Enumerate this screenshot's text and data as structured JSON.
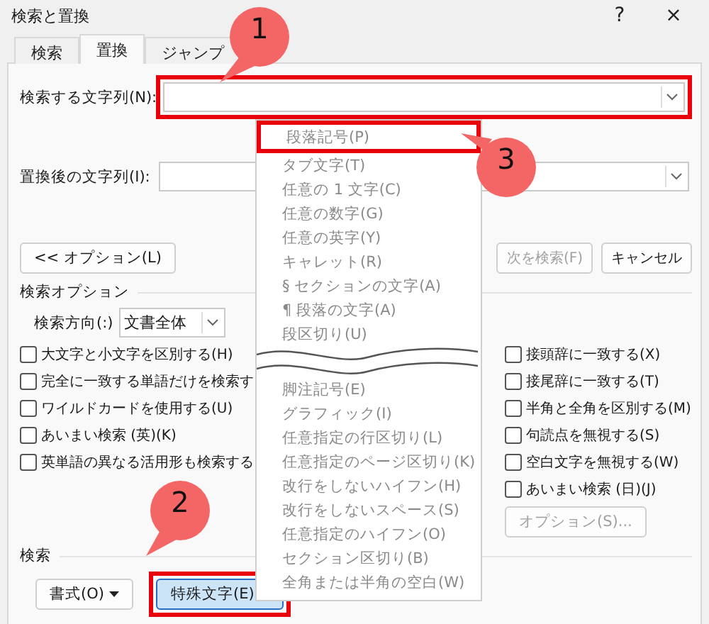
{
  "window": {
    "title": "検索と置換",
    "help": "?",
    "close": "×"
  },
  "tabs": [
    {
      "label": "検索",
      "selected": false
    },
    {
      "label": "置換",
      "selected": true
    },
    {
      "label": "ジャンプ",
      "selected": false
    }
  ],
  "find": {
    "label": "検索する文字列(N):",
    "highlighted": true
  },
  "replace": {
    "label": "置換後の文字列(I):",
    "highlighted": false
  },
  "buttons": [
    {
      "label": "<< オプション(L)",
      "disabled": false
    },
    {
      "label": "次を検索(F)",
      "disabled": true
    },
    {
      "label": "キャンセル",
      "disabled": false
    }
  ],
  "options": {
    "heading": "検索オプション",
    "direction_label": "検索方向(:)",
    "direction_value": "文書全体",
    "left_checks": [
      {
        "label": "大文字と小文字を区別する(H)",
        "checked": false
      },
      {
        "label": "完全に一致する単語だけを検索す",
        "checked": false
      },
      {
        "label": "ワイルドカードを使用する(U)",
        "checked": false
      },
      {
        "label": "あいまい検索 (英)(K)",
        "checked": false
      },
      {
        "label": "英単語の異なる活用形も検索する",
        "checked": false
      }
    ],
    "right_checks": [
      {
        "label": "接頭辞に一致する(X)",
        "checked": false
      },
      {
        "label": "接尾辞に一致する(T)",
        "checked": false
      },
      {
        "label": "半角と全角を区別する(M)",
        "checked": false
      },
      {
        "label": "句読点を無視する(S)",
        "checked": false
      },
      {
        "label": "空白文字を無視する(W)",
        "checked": false
      },
      {
        "label": "あいまい検索 (日)(J)",
        "checked": false
      }
    ],
    "more_button": {
      "label": "オプション(S)...",
      "disabled": true
    }
  },
  "search_section": {
    "heading": "検索",
    "buttons": [
      {
        "label": "書式(O)",
        "selected": false,
        "highlighted": false
      },
      {
        "label": "特殊文字(E)",
        "selected": true,
        "highlighted": true
      }
    ]
  },
  "menu": {
    "items_before": [
      {
        "label": "段落記号(P)",
        "highlighted": true
      },
      {
        "label": "タブ文字(T)",
        "highlighted": false
      },
      {
        "label": "任意の 1 文字(C)",
        "highlighted": false
      },
      {
        "label": "任意の数字(G)",
        "highlighted": false
      },
      {
        "label": "任意の英字(Y)",
        "highlighted": false
      },
      {
        "label": "キャレット(R)",
        "highlighted": false
      },
      {
        "label": "§ セクションの文字(A)",
        "highlighted": false
      },
      {
        "label": "¶ 段落の文字(A)",
        "highlighted": false
      },
      {
        "label": "段区切り(U)",
        "highlighted": false
      }
    ],
    "items_after": [
      {
        "label": "脚注記号(E)",
        "highlighted": false
      },
      {
        "label": "グラフィック(I)",
        "highlighted": false
      },
      {
        "label": "任意指定の行区切り(L)",
        "highlighted": false
      },
      {
        "label": "任意指定のページ区切り(K)",
        "highlighted": false
      },
      {
        "label": "改行をしないハイフン(H)",
        "highlighted": false
      },
      {
        "label": "改行をしないスペース(S)",
        "highlighted": false
      },
      {
        "label": "任意指定のハイフン(O)",
        "highlighted": false
      },
      {
        "label": "セクション区切り(B)",
        "highlighted": false
      },
      {
        "label": "全角または半角の空白(W)",
        "highlighted": false
      }
    ]
  },
  "callouts": [
    {
      "number": "1"
    },
    {
      "number": "2"
    },
    {
      "number": "3"
    }
  ]
}
